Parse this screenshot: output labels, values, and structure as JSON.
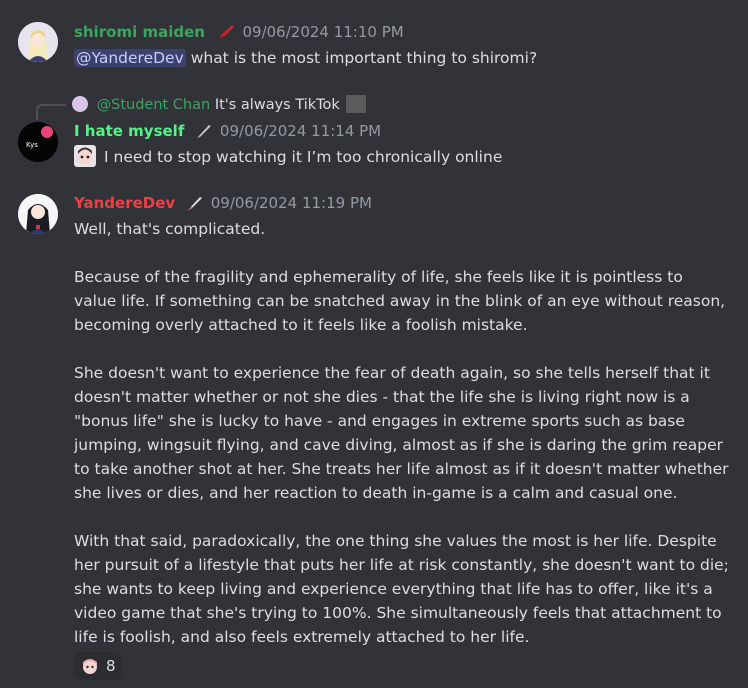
{
  "messages": [
    {
      "username": "shiromi maiden",
      "username_color": "#3ba55d",
      "timestamp": "09/06/2024 11:10 PM",
      "mention": "@YandereDev",
      "text": "what is the most important thing to shiromi?"
    },
    {
      "reply_to_name": "@Student Chan",
      "reply_to_text": "It's always TikTok",
      "username": "I hate myself",
      "username_color": "#57f287",
      "timestamp": "09/06/2024 11:14 PM",
      "avatar_label": "Kys",
      "text": "I need to stop watching it I’m too chronically online"
    },
    {
      "username": "YandereDev",
      "username_color": "#ed4245",
      "timestamp": "09/06/2024 11:19 PM",
      "paragraphs": [
        "Well, that's complicated.",
        "Because of the fragility and ephemerality of life, she feels like it is pointless to value life. If something can be snatched away in the blink of an eye without reason, becoming overly attached to it feels like a foolish mistake.",
        "She doesn't want to experience the fear of death again, so she tells herself that it doesn't matter whether or not she dies - that the life she is living right now is a \"bonus life\" she is lucky to have - and engages in extreme sports such as base jumping, wingsuit flying, and cave diving, almost as if she is daring the grim reaper to take another shot at her. She treats her life almost as if it doesn't matter whether she lives or dies, and her reaction to death in-game is a calm and casual one.",
        "With that said, paradoxically, the one thing she values the most is her life. Despite her pursuit of a lifestyle that puts her life at risk constantly, she doesn't want to die; she wants to keep living and experience everything that life has to offer, like it's a video game that she's trying to 100%. She simultaneously feels that attachment to life is foolish, and also feels extremely attached to her life."
      ],
      "reaction_count": "8"
    }
  ]
}
